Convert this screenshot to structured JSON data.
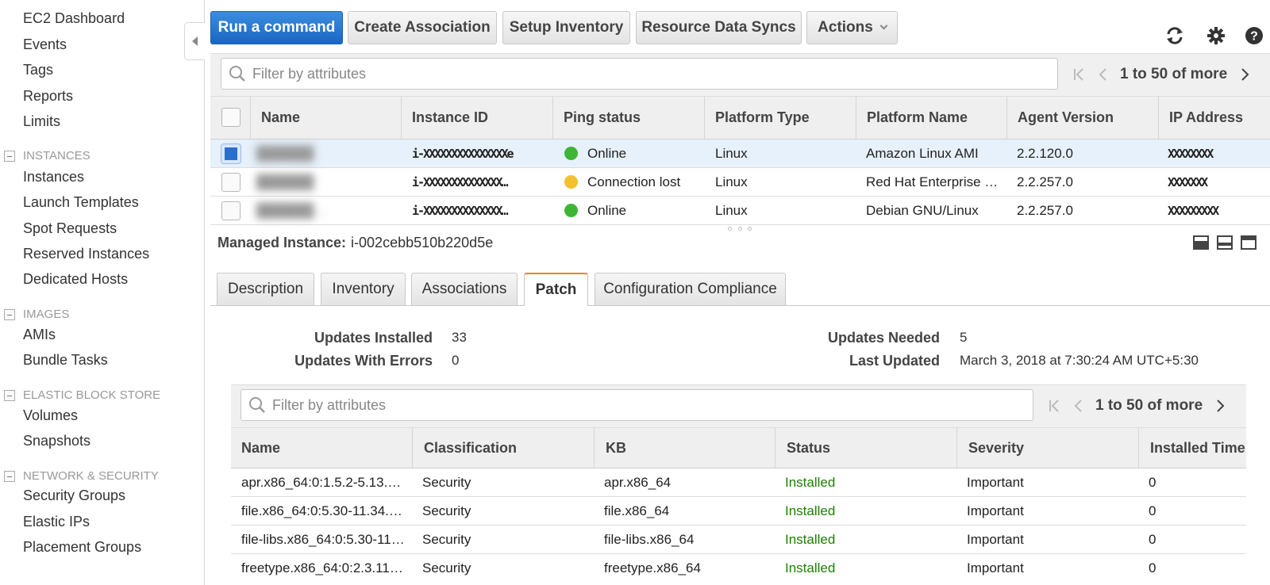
{
  "sidebar": {
    "top_items": [
      "EC2 Dashboard",
      "Events",
      "Tags",
      "Reports",
      "Limits"
    ],
    "sections": [
      {
        "title": "INSTANCES",
        "items": [
          "Instances",
          "Launch Templates",
          "Spot Requests",
          "Reserved Instances",
          "Dedicated Hosts"
        ]
      },
      {
        "title": "IMAGES",
        "items": [
          "AMIs",
          "Bundle Tasks"
        ]
      },
      {
        "title": "ELASTIC BLOCK STORE",
        "items": [
          "Volumes",
          "Snapshots"
        ]
      },
      {
        "title": "NETWORK & SECURITY",
        "items": [
          "Security Groups",
          "Elastic IPs",
          "Placement Groups"
        ]
      }
    ]
  },
  "toolbar": {
    "run_command": "Run a command",
    "create_association": "Create Association",
    "setup_inventory": "Setup Inventory",
    "resource_data_syncs": "Resource Data Syncs",
    "actions": "Actions"
  },
  "instances": {
    "filter_placeholder": "Filter by attributes",
    "pager": "1 to 50 of more",
    "columns": [
      "Name",
      "Instance ID",
      "Ping status",
      "Platform Type",
      "Platform Name",
      "Agent Version",
      "IP Address"
    ],
    "rows": [
      {
        "name": "██████",
        "instance_id": "i-XXXXXXXXXXXXXXXe",
        "ping": "Online",
        "ping_color": "#3fb536",
        "platform_type": "Linux",
        "platform_name": "Amazon Linux AMI",
        "agent": "2.2.120.0",
        "ip": "XXXXXXXX",
        "selected": true
      },
      {
        "name": "██████",
        "instance_id": "i-XXXXXXXXXXXXXX…",
        "ping": "Connection lost",
        "ping_color": "#f2c12e",
        "platform_type": "Linux",
        "platform_name": "Red Hat Enterprise …",
        "agent": "2.2.257.0",
        "ip": "XXXXXXX",
        "selected": false
      },
      {
        "name": "██████…",
        "instance_id": "i-XXXXXXXXXXXXXX…",
        "ping": "Online",
        "ping_color": "#3fb536",
        "platform_type": "Linux",
        "platform_name": "Debian GNU/Linux",
        "agent": "2.2.257.0",
        "ip": "XXXXXXXXX",
        "selected": false
      }
    ]
  },
  "managed_instance": {
    "label": "Managed Instance:",
    "id": "i-002cebb510b220d5e"
  },
  "tabs": [
    "Description",
    "Inventory",
    "Associations",
    "Patch",
    "Configuration Compliance"
  ],
  "active_tab": "Patch",
  "patch_summary": {
    "updates_installed_label": "Updates Installed",
    "updates_installed": "33",
    "updates_with_errors_label": "Updates With Errors",
    "updates_with_errors": "0",
    "updates_needed_label": "Updates Needed",
    "updates_needed": "5",
    "last_updated_label": "Last Updated",
    "last_updated": "March 3, 2018 at 7:30:24 AM UTC+5:30"
  },
  "patches": {
    "filter_placeholder": "Filter by attributes",
    "pager": "1 to 50 of more",
    "columns": [
      "Name",
      "Classification",
      "KB",
      "Status",
      "Severity",
      "Installed Time"
    ],
    "rows": [
      {
        "name": "apr.x86_64:0:1.5.2-5.13.…",
        "classification": "Security",
        "kb": "apr.x86_64",
        "status": "Installed",
        "severity": "Important",
        "installed_time": "0"
      },
      {
        "name": "file.x86_64:0:5.30-11.34.…",
        "classification": "Security",
        "kb": "file.x86_64",
        "status": "Installed",
        "severity": "Important",
        "installed_time": "0"
      },
      {
        "name": "file-libs.x86_64:0:5.30-11…",
        "classification": "Security",
        "kb": "file-libs.x86_64",
        "status": "Installed",
        "severity": "Important",
        "installed_time": "0"
      },
      {
        "name": "freetype.x86_64:0:2.3.11…",
        "classification": "Security",
        "kb": "freetype.x86_64",
        "status": "Installed",
        "severity": "Important",
        "installed_time": "0"
      }
    ]
  },
  "colors": {
    "primary": "#1a66c2",
    "installed": "#1d8102",
    "tab_accent": "#e8860d"
  },
  "icons": [
    "refresh-icon",
    "gear-icon",
    "help-icon",
    "search-icon",
    "first-page-icon",
    "prev-page-icon",
    "next-page-icon"
  ]
}
